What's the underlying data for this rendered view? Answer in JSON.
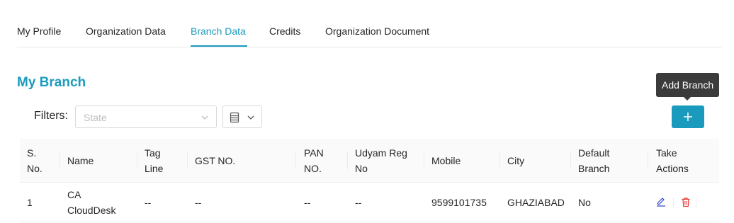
{
  "tabs": [
    {
      "label": "My Profile",
      "active": false
    },
    {
      "label": "Organization Data",
      "active": false
    },
    {
      "label": "Branch Data",
      "active": true
    },
    {
      "label": "Credits",
      "active": false
    },
    {
      "label": "Organization Document",
      "active": false
    }
  ],
  "page": {
    "title": "My Branch"
  },
  "tooltip": {
    "text": "Add Branch"
  },
  "filters": {
    "label": "Filters:",
    "state_placeholder": "State",
    "columns_icon": "columns-icon"
  },
  "add_button": {
    "icon": "plus-icon"
  },
  "table": {
    "columns": [
      {
        "line1": "S.",
        "line2": "No."
      },
      {
        "line1": "Name",
        "line2": ""
      },
      {
        "line1": "Tag",
        "line2": "Line"
      },
      {
        "line1": "GST NO.",
        "line2": ""
      },
      {
        "line1": "PAN",
        "line2": "NO."
      },
      {
        "line1": "Udyam Reg",
        "line2": "No"
      },
      {
        "line1": "Mobile",
        "line2": ""
      },
      {
        "line1": "City",
        "line2": ""
      },
      {
        "line1": "Default",
        "line2": "Branch"
      },
      {
        "line1": "Take",
        "line2": "Actions"
      }
    ],
    "rows": [
      {
        "sno": "1",
        "name_line1": "CA",
        "name_line2": "CloudDesk",
        "tag_line": "--",
        "gst_no": "--",
        "pan_no": "--",
        "udyam_reg_no": "--",
        "mobile": "9599101735",
        "city": "GHAZIABAD",
        "default_branch": "No",
        "actions": [
          "edit-icon",
          "delete-icon"
        ]
      }
    ]
  },
  "colors": {
    "accent": "#1a9bbd",
    "delete": "#e53935",
    "edit": "#2a3fd6"
  }
}
